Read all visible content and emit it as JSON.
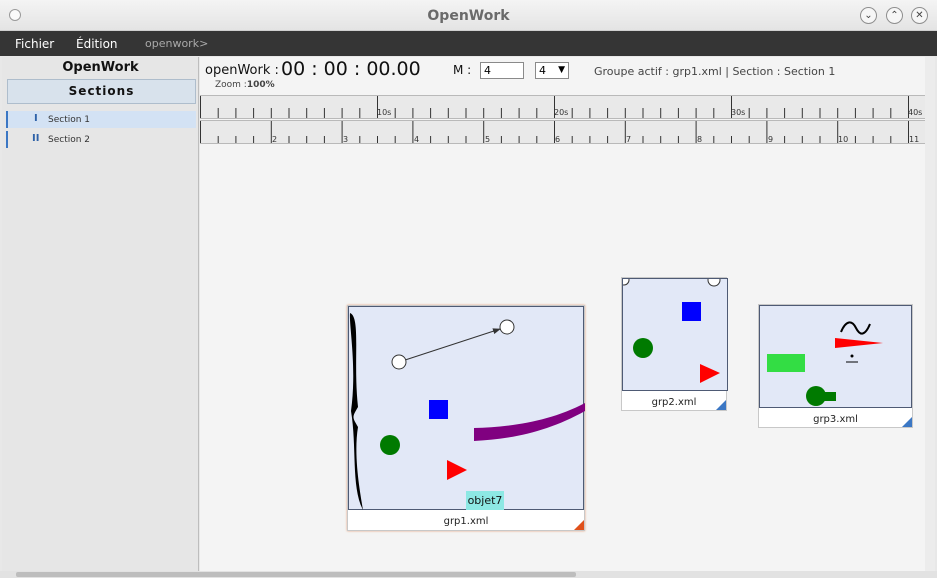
{
  "window": {
    "title": "OpenWork"
  },
  "menu": {
    "file": "Fichier",
    "edit": "Édition",
    "path": "openwork>"
  },
  "sidebar": {
    "title": "OpenWork",
    "header": "Sections",
    "items": [
      {
        "numeral": "I",
        "label": "Section 1",
        "active": true
      },
      {
        "numeral": "II",
        "label": "Section 2",
        "active": false
      }
    ]
  },
  "info": {
    "app_label": "openWork :",
    "clock": "00 : 00 : 00.00",
    "m_label": "M :",
    "m_value": "4",
    "m_select": "4",
    "status": "Groupe actif : grp1.xml | Section : Section 1",
    "zoom_label": "Zoom :",
    "zoom_value": "100%"
  },
  "ruler_top": {
    "labels": [
      "10s",
      "20s",
      "30s",
      "40s"
    ]
  },
  "ruler_bottom": {
    "labels": [
      "2",
      "3",
      "4",
      "5",
      "6",
      "7",
      "8",
      "9",
      "10",
      "11"
    ]
  },
  "groups": [
    {
      "name": "grp1.xml",
      "object_label": "objet7",
      "corner_color": "#e0501a"
    },
    {
      "name": "grp2.xml",
      "corner_color": "#3b77c4"
    },
    {
      "name": "grp3.xml",
      "corner_color": "#3b77c4"
    }
  ],
  "colors": {
    "blue_square": "#0000ff",
    "green_circle": "#007a00",
    "red_triangle": "#ff0000",
    "purple_curve": "#800080",
    "green_rect": "#33dd44",
    "label_bg": "#8de8e4"
  }
}
